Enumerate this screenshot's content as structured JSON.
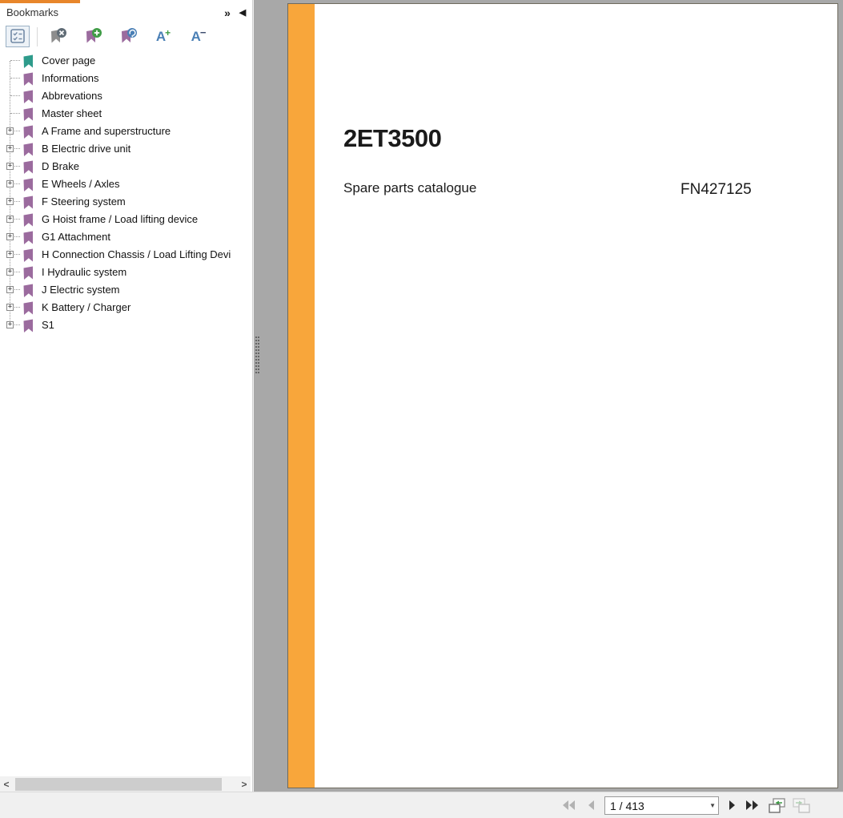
{
  "sidebar": {
    "title": "Bookmarks",
    "toolbar_icons": [
      "options-icon",
      "delete-bookmark-icon",
      "new-bookmark-icon",
      "goto-bookmark-icon",
      "font-increase-icon",
      "font-decrease-icon"
    ],
    "bookmarks": [
      {
        "label": "Cover page",
        "expandable": false,
        "color": "teal"
      },
      {
        "label": "Informations",
        "expandable": false,
        "color": "purple"
      },
      {
        "label": "Abbrevations",
        "expandable": false,
        "color": "purple"
      },
      {
        "label": "Master sheet",
        "expandable": false,
        "color": "purple"
      },
      {
        "label": "A Frame and superstructure",
        "expandable": true,
        "color": "purple"
      },
      {
        "label": "B Electric drive unit",
        "expandable": true,
        "color": "purple"
      },
      {
        "label": "D Brake",
        "expandable": true,
        "color": "purple"
      },
      {
        "label": "E Wheels / Axles",
        "expandable": true,
        "color": "purple"
      },
      {
        "label": "F Steering system",
        "expandable": true,
        "color": "purple"
      },
      {
        "label": "G Hoist frame / Load lifting device",
        "expandable": true,
        "color": "purple"
      },
      {
        "label": "G1 Attachment",
        "expandable": true,
        "color": "purple"
      },
      {
        "label": "H Connection Chassis / Load Lifting Devi",
        "expandable": true,
        "color": "purple"
      },
      {
        "label": "I Hydraulic system",
        "expandable": true,
        "color": "purple"
      },
      {
        "label": "J Electric system",
        "expandable": true,
        "color": "purple"
      },
      {
        "label": "K Battery / Charger",
        "expandable": true,
        "color": "purple"
      },
      {
        "label": "S1",
        "expandable": true,
        "color": "purple"
      }
    ]
  },
  "document": {
    "title": "2ET3500",
    "subtitle": "Spare parts catalogue",
    "part_number": "FN427125"
  },
  "statusbar": {
    "page_indicator": "1 / 413"
  },
  "icons": {
    "expand_panels": "»",
    "collapse_panel": "◀",
    "expander": "+",
    "scroll_left": "<",
    "scroll_right": ">",
    "dropdown_caret": "▼",
    "font_increase": {
      "letter": "A",
      "sign": "+"
    },
    "font_decrease": {
      "letter": "A",
      "sign": "−"
    }
  },
  "colors": {
    "accent_orange": "#F8A63B",
    "tab_indicator_orange": "#E8862B",
    "bookmark_purple": "#9B6B9E",
    "bookmark_teal": "#2E9B8B",
    "pasteboard_gray": "#A8A8A8"
  }
}
